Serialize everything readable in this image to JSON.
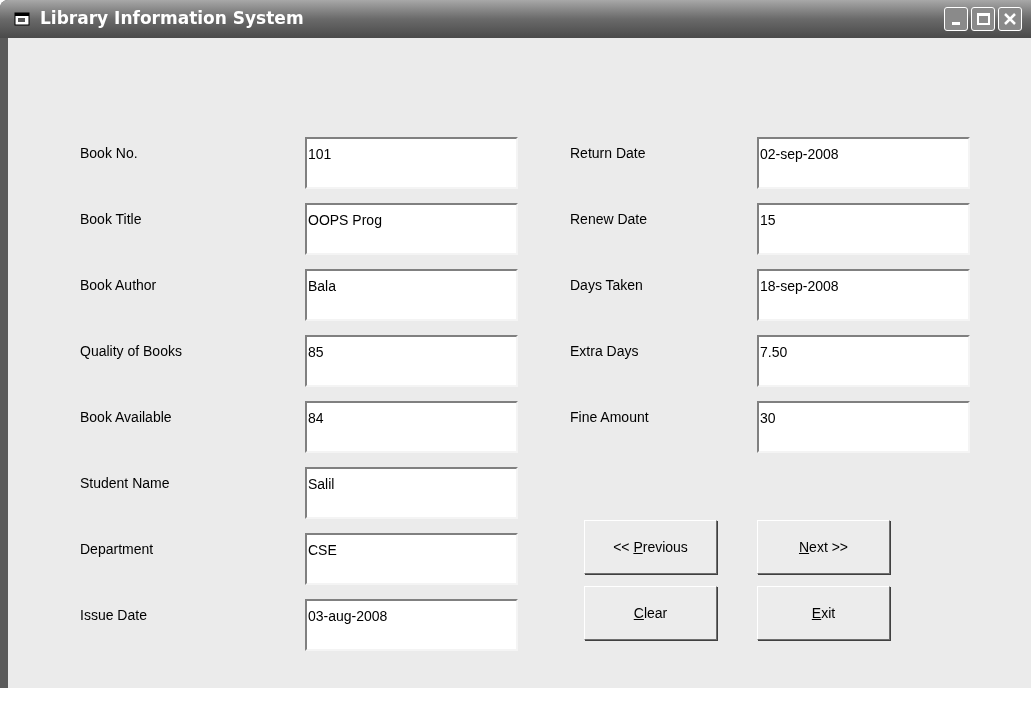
{
  "window": {
    "title": "Library Information System"
  },
  "left_fields": [
    {
      "label": "Book No.",
      "value": "101"
    },
    {
      "label": "Book Title",
      "value": "OOPS Prog"
    },
    {
      "label": "Book Author",
      "value": "Bala"
    },
    {
      "label": "Quality of Books",
      "value": "85"
    },
    {
      "label": "Book Available",
      "value": "84"
    },
    {
      "label": "Student Name",
      "value": "Salil"
    },
    {
      "label": "Department",
      "value": "CSE"
    },
    {
      "label": "Issue Date",
      "value": "03-aug-2008"
    }
  ],
  "right_fields": [
    {
      "label": "Return Date",
      "value": "02-sep-2008"
    },
    {
      "label": "Renew Date",
      "value": "15"
    },
    {
      "label": "Days Taken",
      "value": "18-sep-2008"
    },
    {
      "label": "Extra Days",
      "value": "7.50"
    },
    {
      "label": "Fine Amount",
      "value": "30"
    }
  ],
  "buttons": [
    {
      "before": "<< ",
      "access_key": "P",
      "after": "revious"
    },
    {
      "access_key": "N",
      "after": "ext >>"
    },
    {
      "access_key": "C",
      "after": "lear"
    },
    {
      "access_key": "E",
      "after": "xit"
    }
  ]
}
